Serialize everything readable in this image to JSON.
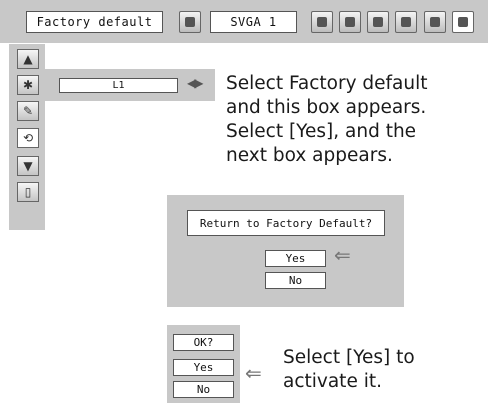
{
  "topbar": {
    "menu_label": "Factory default",
    "input_label": "SVGA 1",
    "icons": [
      "image-adjust-icon",
      "screen-icon",
      "setting-icon",
      "expand-icon",
      "picture-icon",
      "input-icon",
      "factory-default-icon"
    ]
  },
  "left_menu": {
    "icons": [
      "scroll-up-icon",
      "fan-off-icon",
      "lamp-icon",
      "factory-reset-icon",
      "scroll-down-icon",
      "exit-icon"
    ]
  },
  "lamp_row": {
    "value": "L1",
    "arrows": "◀▶"
  },
  "notes": {
    "first": [
      "Select Factory default",
      "and this box appears.",
      "Select [Yes], and the",
      "next box appears."
    ],
    "second": [
      "Select [Yes] to",
      "activate it."
    ]
  },
  "dialog1": {
    "question": "Return to Factory Default?",
    "yes": "Yes",
    "no": "No"
  },
  "dialog2": {
    "question": "OK?",
    "yes": "Yes",
    "no": "No"
  },
  "pointer": "⇐",
  "colors": {
    "panel": "#c8c8c8",
    "box": "#ffffff",
    "border": "#555555"
  }
}
